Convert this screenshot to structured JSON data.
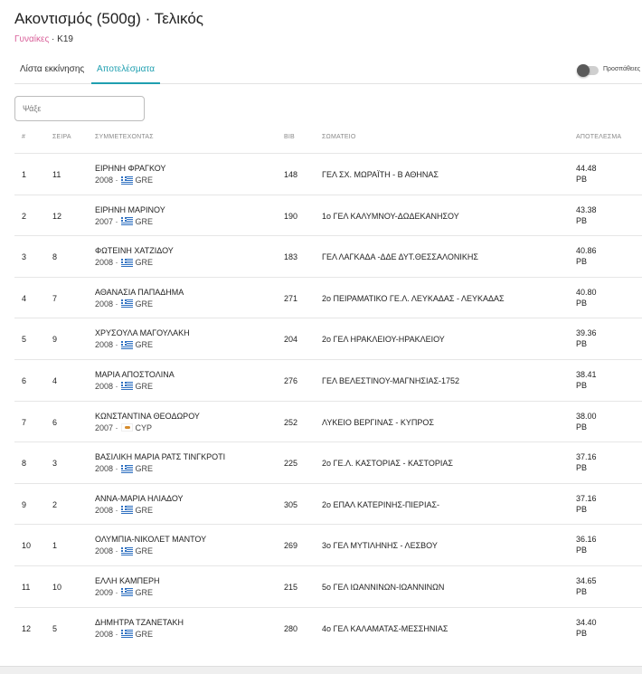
{
  "header": {
    "title": "Ακοντισμός (500g) · Τελικός",
    "category": "Γυναίκες",
    "separator": " · ",
    "age_group": "K19"
  },
  "tabs": [
    {
      "label": "Λίστα εκκίνησης",
      "active": false
    },
    {
      "label": "Αποτελέσματα",
      "active": true
    }
  ],
  "toggle": {
    "label": "Προσπάθειες",
    "on": false
  },
  "search": {
    "placeholder": "Ψάξε",
    "value": ""
  },
  "columns": {
    "rank": "#",
    "lane": "ΣΕΙΡΑ",
    "athletes": "ΣΥΜΜΕΤΕΧΟΝΤΑΣ",
    "bib": "BIB",
    "club": "ΣΩΜΑΤΕΙΟ",
    "result": "ΑΠΟΤΕΛΕΣΜΑ"
  },
  "rows": [
    {
      "rank": "1",
      "lane": "11",
      "name": "ΕΙΡΗΝΗ ΦΡΑΓΚΟΥ",
      "year": "2008",
      "flag": "flag-gre",
      "country": "GRE",
      "bib": "148",
      "club": "ΓΕΛ ΣΧ. ΜΩΡΑΪΤΗ - Β ΑΘΗΝΑΣ",
      "mark": "44.48",
      "note": "PB"
    },
    {
      "rank": "2",
      "lane": "12",
      "name": "ΕΙΡΗΝΗ ΜΑΡΙΝΟΥ",
      "year": "2007",
      "flag": "flag-gre",
      "country": "GRE",
      "bib": "190",
      "club": "1ο ΓΕΛ ΚΑΛΥΜΝΟΥ-ΔΩΔΕΚΑΝΗΣΟΥ",
      "mark": "43.38",
      "note": "PB"
    },
    {
      "rank": "3",
      "lane": "8",
      "name": "ΦΩΤΕΙΝΗ ΧΑΤΖΙΔΟΥ",
      "year": "2008",
      "flag": "flag-gre",
      "country": "GRE",
      "bib": "183",
      "club": "ΓΕΛ ΛΑΓΚΑΔΑ -ΔΔΕ ΔΥΤ.ΘΕΣΣΑΛΟΝΙΚΗΣ",
      "mark": "40.86",
      "note": "PB"
    },
    {
      "rank": "4",
      "lane": "7",
      "name": "ΑΘΑΝΑΣΙΑ ΠΑΠΑΔΗΜΑ",
      "year": "2008",
      "flag": "flag-gre",
      "country": "GRE",
      "bib": "271",
      "club": "2ο ΠΕΙΡΑΜΑΤΙΚΟ ΓΕ.Λ. ΛΕΥΚΑΔΑΣ - ΛΕΥΚΑΔΑΣ",
      "mark": "40.80",
      "note": "PB"
    },
    {
      "rank": "5",
      "lane": "9",
      "name": "ΧΡΥΣΟΥΛΑ ΜΑΓΟΥΛΑΚΗ",
      "year": "2008",
      "flag": "flag-gre",
      "country": "GRE",
      "bib": "204",
      "club": "2ο ΓΕΛ ΗΡΑΚΛΕΙΟΥ-ΗΡΑΚΛΕΙΟΥ",
      "mark": "39.36",
      "note": "PB"
    },
    {
      "rank": "6",
      "lane": "4",
      "name": "ΜΑΡΙΑ ΑΠΟΣΤΟΛΙΝΑ",
      "year": "2008",
      "flag": "flag-gre",
      "country": "GRE",
      "bib": "276",
      "club": "ΓΕΛ ΒΕΛΕΣΤΙΝΟΥ-ΜΑΓΝΗΣΙΑΣ-1752",
      "mark": "38.41",
      "note": "PB"
    },
    {
      "rank": "7",
      "lane": "6",
      "name": "ΚΩΝΣΤΑΝΤΙΝΑ ΘΕΟΔΩΡΟΥ",
      "year": "2007",
      "flag": "flag-cyp",
      "country": "CYP",
      "bib": "252",
      "club": "ΛΥΚΕΙΟ ΒΕΡΓΙΝΑΣ - ΚΥΠΡΟΣ",
      "mark": "38.00",
      "note": "PB"
    },
    {
      "rank": "8",
      "lane": "3",
      "name": "ΒΑΣΙΛΙΚΗ ΜΑΡΙΑ ΡΑΤΣ ΤΙΝΓΚΡΟΤΙ",
      "year": "2008",
      "flag": "flag-gre",
      "country": "GRE",
      "bib": "225",
      "club": "2ο ΓΕ.Λ. ΚΑΣΤΟΡΙΑΣ - ΚΑΣΤΟΡΙΑΣ",
      "mark": "37.16",
      "note": "PB"
    },
    {
      "rank": "9",
      "lane": "2",
      "name": "ΑΝΝΑ-ΜΑΡΙΑ ΗΛΙΑΔΟΥ",
      "year": "2008",
      "flag": "flag-gre",
      "country": "GRE",
      "bib": "305",
      "club": "2ο ΕΠΑΛ ΚΑΤΕΡΙΝΗΣ-ΠΙΕΡΙΑΣ-",
      "mark": "37.16",
      "note": "PB"
    },
    {
      "rank": "10",
      "lane": "1",
      "name": "ΟΛΥΜΠΙΑ-ΝΙΚΟΛΕΤ ΜΑΝΤΟΥ",
      "year": "2008",
      "flag": "flag-gre",
      "country": "GRE",
      "bib": "269",
      "club": "3ο ΓΕΛ ΜΥΤΙΛΗΝΗΣ - ΛΕΣΒΟΥ",
      "mark": "36.16",
      "note": "PB"
    },
    {
      "rank": "11",
      "lane": "10",
      "name": "ΕΛΛΗ ΚΑΜΠΕΡΗ",
      "year": "2009",
      "flag": "flag-gre",
      "country": "GRE",
      "bib": "215",
      "club": "5ο ΓΕΛ ΙΩΑΝΝΙΝΩΝ-ΙΩΑΝΝΙΝΩΝ",
      "mark": "34.65",
      "note": "PB"
    },
    {
      "rank": "12",
      "lane": "5",
      "name": "ΔΗΜΗΤΡΑ ΤΖΑΝΕΤΑΚΗ",
      "year": "2008",
      "flag": "flag-gre",
      "country": "GRE",
      "bib": "280",
      "club": "4ο ΓΕΛ ΚΑΛΑΜΑΤΑΣ-ΜΕΣΣΗΝΙΑΣ",
      "mark": "34.40",
      "note": "PB"
    }
  ]
}
